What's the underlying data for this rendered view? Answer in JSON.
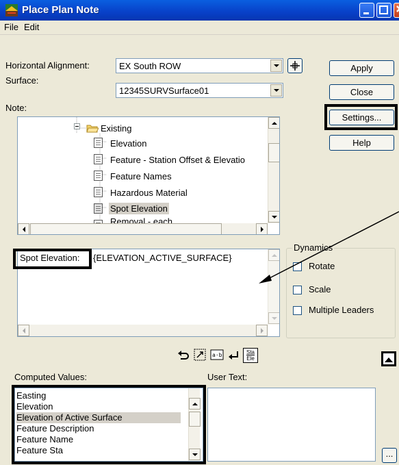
{
  "window": {
    "title": "Place Plan Note"
  },
  "menu": {
    "file": "File",
    "edit": "Edit"
  },
  "form": {
    "horizontal_alignment_label": "Horizontal Alignment:",
    "horizontal_alignment_value": "EX South ROW",
    "surface_label": "Surface:",
    "surface_value": "12345SURVSurface01",
    "note_label": "Note:"
  },
  "buttons": {
    "apply": "Apply",
    "close": "Close",
    "settings": "Settings...",
    "help": "Help",
    "browse": "..."
  },
  "tree": {
    "folder": "Existing",
    "items": [
      "Elevation",
      "Feature - Station Offset & Elevatio",
      "Feature Names",
      "Hazardous Material",
      "Spot Elevation",
      "Removal - each"
    ],
    "selected": "Spot Elevation"
  },
  "note_text": {
    "prefix": "Spot Elevation:",
    "expression": "{ELEVATION_ACTIVE_SURFACE}"
  },
  "dynamics": {
    "title": "Dynamics",
    "rotate": {
      "label": "Rotate",
      "checked": false
    },
    "scale": {
      "label": "Scale",
      "checked": false
    },
    "multiple_leaders": {
      "label": "Multiple Leaders",
      "checked": false
    }
  },
  "toolbar_icons": [
    "undo-icon",
    "select-icon",
    "insert-value-icon",
    "newline-icon",
    "station-elevation-icon"
  ],
  "station_icon_text": {
    "top": "Sta",
    "bottom": "Ele"
  },
  "computed_values": {
    "label": "Computed Values:",
    "items": [
      "Easting",
      "Elevation",
      "Elevation of Active Surface",
      "Feature Description",
      "Feature Name",
      "Feature Sta"
    ],
    "selected": "Elevation of Active Surface"
  },
  "user_text": {
    "label": "User Text:",
    "value": ""
  },
  "colors": {
    "title_bar": "#0840c8",
    "highlight": "#000000",
    "selection": "#d4d0c8"
  }
}
